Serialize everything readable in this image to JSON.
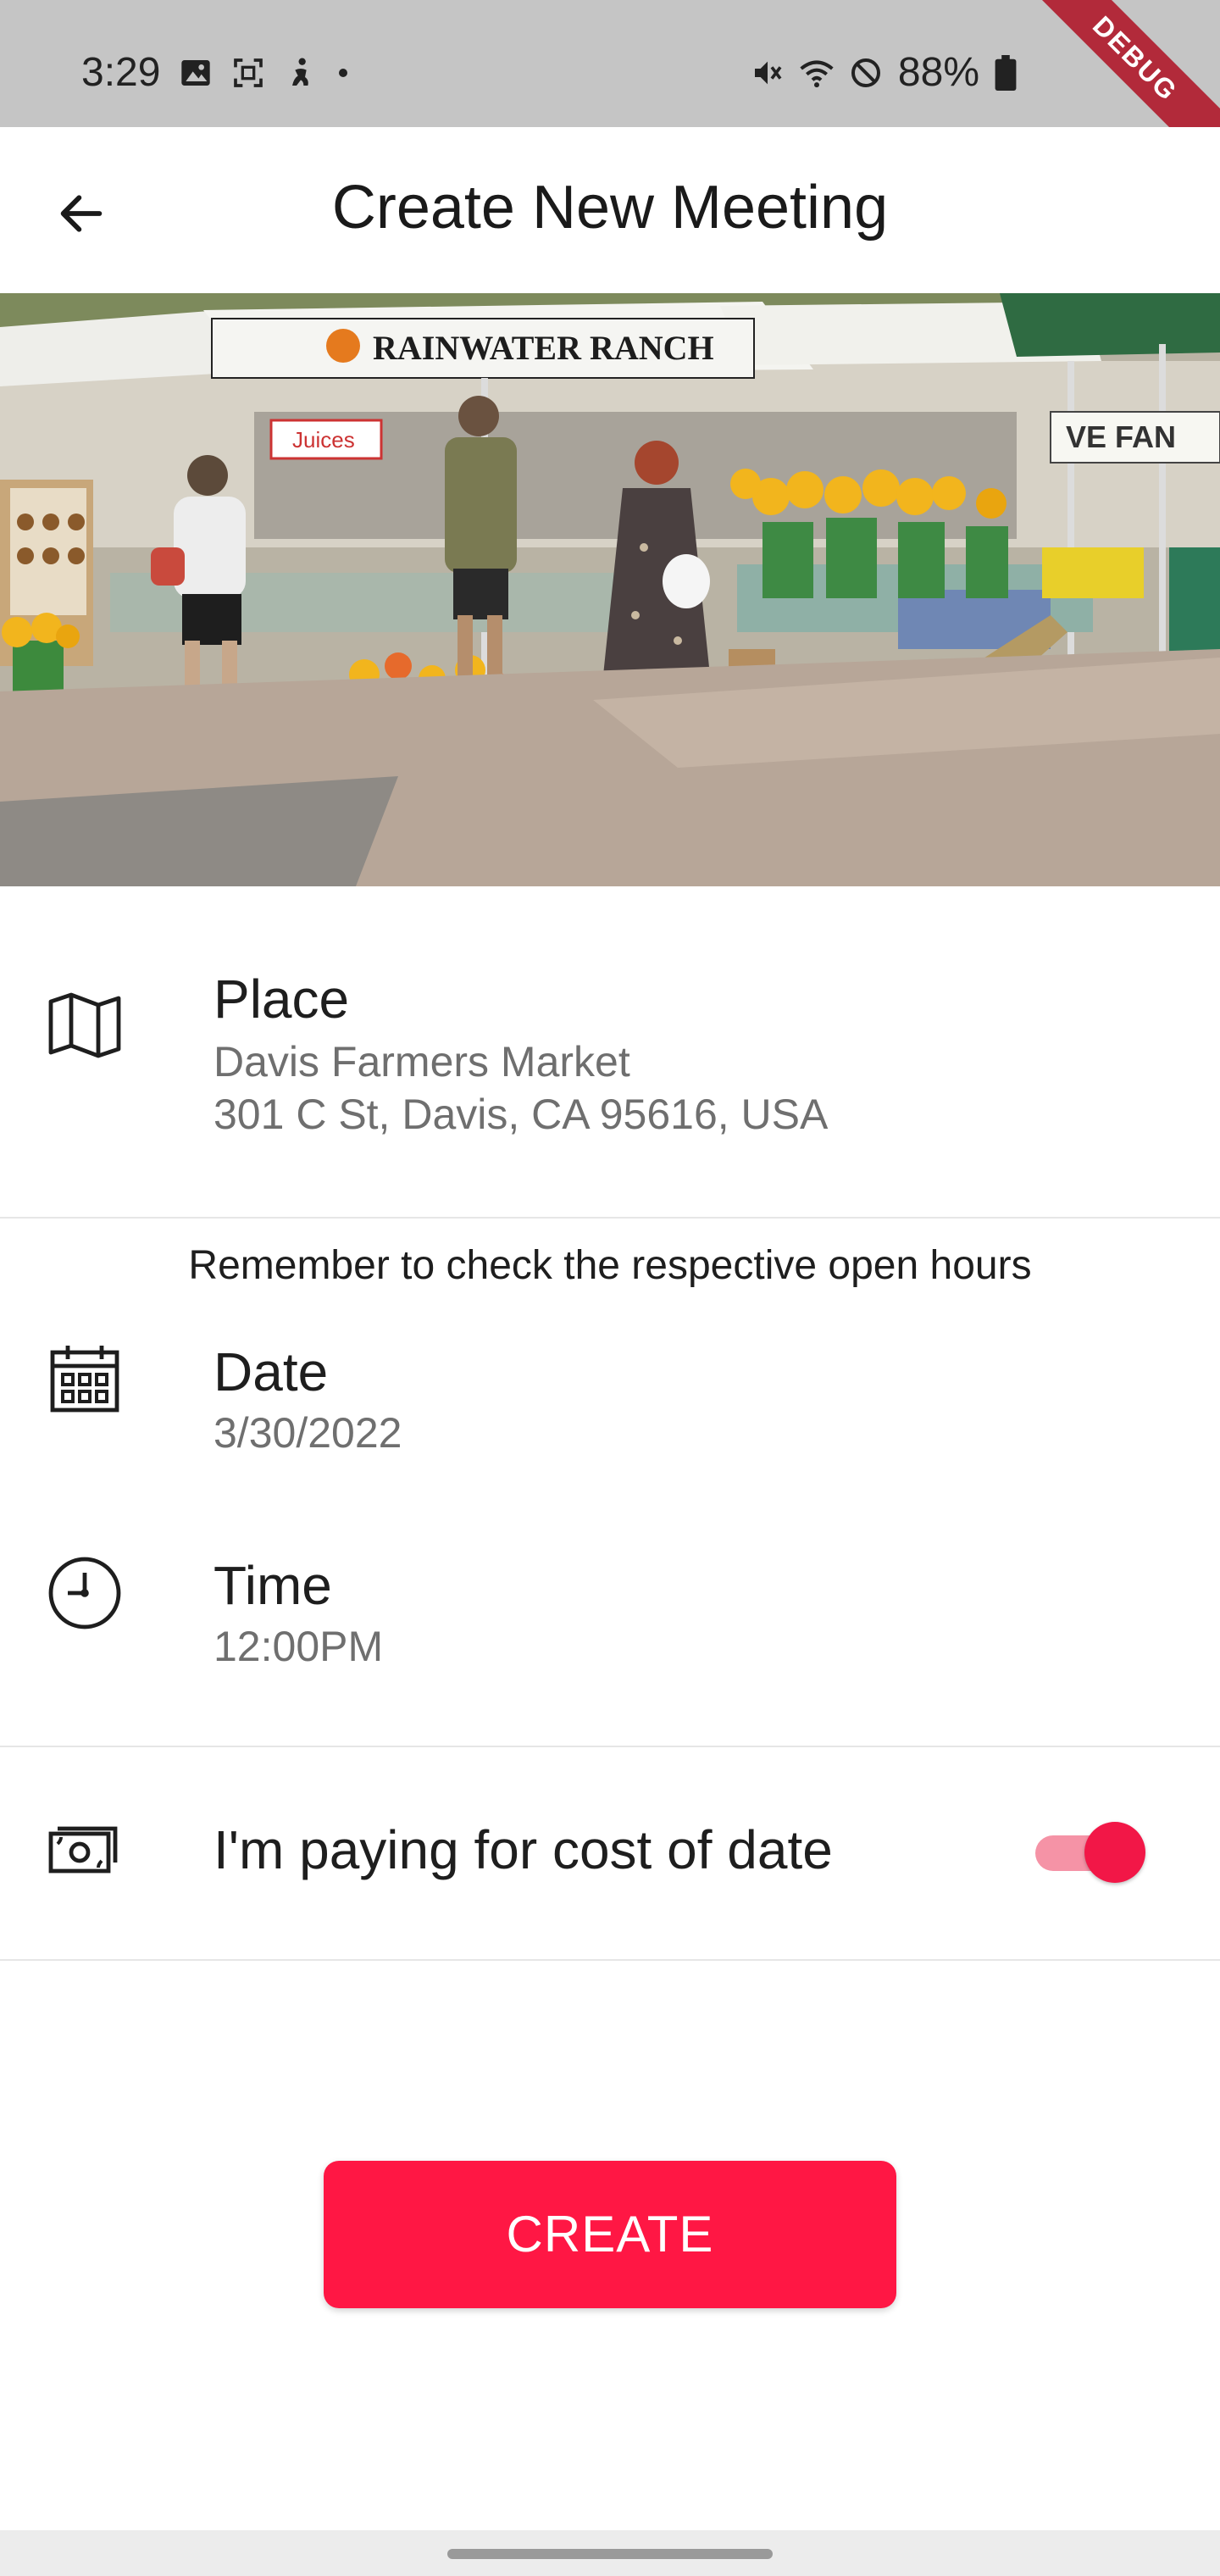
{
  "status_bar": {
    "time": "3:29",
    "battery": "88%",
    "debug_label": "DEBUG",
    "icons_left": [
      "image-icon",
      "screenshot-icon",
      "accessibility-icon",
      "dot-icon"
    ],
    "icons_right": [
      "mute-icon",
      "wifi-icon",
      "do-not-disturb-icon",
      "battery-icon"
    ]
  },
  "app_bar": {
    "title": "Create New Meeting",
    "back_icon": "arrow-left-icon"
  },
  "hero": {
    "banner_text": "RAINWATER RANCH",
    "juice_sign": "Juices",
    "right_sign": "VE FAN"
  },
  "place": {
    "title": "Place",
    "name": "Davis Farmers Market",
    "address": "301 C St, Davis, CA 95616, USA",
    "icon": "map-icon"
  },
  "note": "Remember to check the respective open hours",
  "date": {
    "title": "Date",
    "value": "3/30/2022",
    "icon": "calendar-icon"
  },
  "time": {
    "title": "Time",
    "value": "12:00PM",
    "icon": "clock-icon"
  },
  "payment": {
    "label": "I'm paying for cost of date",
    "icon": "money-icon",
    "toggle_on": true
  },
  "create_button": {
    "label": "CREATE"
  },
  "colors": {
    "accent": "#ff1744",
    "toggle_track": "#f593a6",
    "status_bar": "#c5c5c5",
    "debug_ribbon": "#b22a3a"
  }
}
